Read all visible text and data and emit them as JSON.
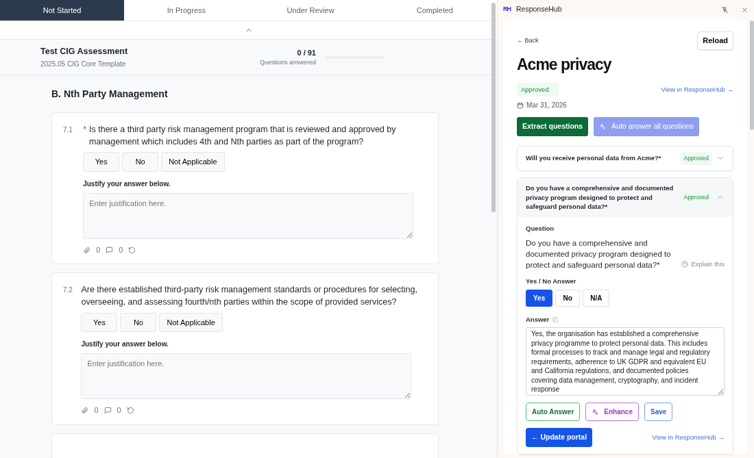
{
  "tabs": [
    {
      "label": "Not Started",
      "selected": true
    },
    {
      "label": "In Progress",
      "selected": false
    },
    {
      "label": "Under Review",
      "selected": false
    },
    {
      "label": "Completed",
      "selected": false
    }
  ],
  "assessment": {
    "title": "Test CIG Assessment",
    "subtitle": "2025.05 CIG Core Template",
    "count": "0 / 91",
    "count_label": "Questions answered",
    "level": 0
  },
  "section_title": "B. Nth Party Management",
  "questions": [
    {
      "number": "7.1",
      "required": true,
      "required_mark": "*",
      "text": "Is there a third party risk management program that is reviewed and approved by management which includes 4th and Nth parties as part of the program?",
      "options": [
        "Yes",
        "No",
        "Not Applicable"
      ],
      "justify_label": "Justify your answer below.",
      "placeholder": "Enter justification here.",
      "attachments": "0",
      "comments": "0"
    },
    {
      "number": "7.2",
      "required": false,
      "text": "Are there established third-party risk management standards or procedures for selecting, overseeing, and assessing fourth/nth parties within the scope of provided services?",
      "options": [
        "Yes",
        "No",
        "Not Applicable"
      ],
      "justify_label": "Justify your answer below.",
      "placeholder": "Enter justification here.",
      "attachments": "0",
      "comments": "0"
    }
  ],
  "panel": {
    "logo": "RH",
    "app_name": "ResponseHub",
    "back": "← Back",
    "reload": "Reload",
    "title": "Acme privacy",
    "status": "Approved",
    "view_link": "View in ResponseHub →",
    "date": "Mar 31, 2026",
    "extract": "Extract questions",
    "auto_all": "Auto answer all questions",
    "items": [
      {
        "text": "Will you receive personal data from Acme?*",
        "status": "Approved",
        "expanded": false
      },
      {
        "text": "Do you have a comprehensive and documented privacy program designed to protect and safeguard personal data?*",
        "status": "Approved",
        "expanded": true
      }
    ],
    "detail": {
      "question_label": "Question",
      "question": "Do you have a comprehensive and documented privacy program designed to protect and safeguard personal data?*",
      "explain": "Explain this",
      "yesno_label": "Yes / No Answer",
      "options": [
        {
          "label": "Yes",
          "selected": true
        },
        {
          "label": "No",
          "selected": false
        },
        {
          "label": "N/A",
          "selected": false
        }
      ],
      "answer_label": "Answer",
      "answer": "Yes, the organisation has established a comprehensive privacy programme to protect personal data. This includes formal processes to track and manage legal and regulatory requirements, adherence to UK GDPR and equivalent EU and California regulations, and documented policies covering data management, cryptography, and incident response",
      "actions": [
        {
          "label": "Auto Answer",
          "kind": "green"
        },
        {
          "label": "Enhance",
          "kind": "sparkle"
        },
        {
          "label": "Save",
          "kind": "blue"
        }
      ],
      "update": "← Update portal",
      "view_link": "View in ResponseHub →"
    }
  }
}
